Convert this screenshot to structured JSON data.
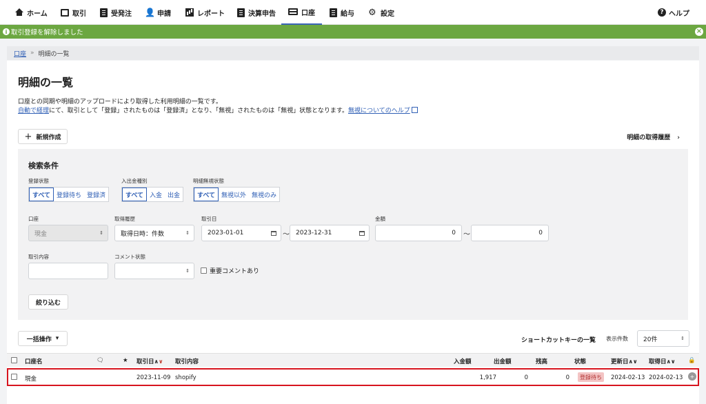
{
  "nav": {
    "items": [
      {
        "label": "ホーム",
        "icon": "home-icon"
      },
      {
        "label": "取引",
        "icon": "monitor-icon"
      },
      {
        "label": "受発注",
        "icon": "document-icon"
      },
      {
        "label": "申請",
        "icon": "person-check-icon"
      },
      {
        "label": "レポート",
        "icon": "bar-chart-icon"
      },
      {
        "label": "決算申告",
        "icon": "document-icon"
      },
      {
        "label": "口座",
        "icon": "credit-card-icon"
      },
      {
        "label": "給与",
        "icon": "list-icon"
      },
      {
        "label": "設定",
        "icon": "gear-icon"
      }
    ],
    "active": "口座",
    "help_label": "ヘルプ",
    "help_icon": "?"
  },
  "banner": {
    "message": "取引登録を解除しました",
    "info_icon": "i",
    "close_icon": "×",
    "color": "#6ca741"
  },
  "breadcrumb": {
    "parent": "口座",
    "separator": "»",
    "current": "明細の一覧"
  },
  "page": {
    "title": "明細の一覧",
    "desc_line1": "口座との同期や明細のアップロードにより取得した利用明細の一覧です。",
    "desc_link1": "自動で経理",
    "desc_line2": "にて、取引として「登録」されたものは「登録済」となり、「無視」されたものは「無視」状態となります。",
    "desc_link2": "無視についてのヘルプ",
    "new_button": "新規作成",
    "new_plus": "+",
    "history_link": "明細の取得履歴",
    "history_chevron": "›"
  },
  "search": {
    "title": "検索条件",
    "registration_label": "登録状態",
    "registration_options": [
      "すべて",
      "登録待ち",
      "登録済"
    ],
    "inout_label": "入出金種別",
    "inout_options": [
      "すべて",
      "入金",
      "出金"
    ],
    "ignore_label": "明細無視状態",
    "ignore_options": [
      "すべて",
      "無視以外",
      "無視のみ"
    ],
    "account_label": "口座",
    "account_value": "現金",
    "history_label": "取得履歴",
    "history_value": "取得日時：件数",
    "date_label": "取引日",
    "date_from": "2023-01-01",
    "date_to": "2023-12-31",
    "amount_label": "金額",
    "amount_from": "0",
    "amount_to": "0",
    "tilde": "〜",
    "content_label": "取引内容",
    "comment_label": "コメント状態",
    "important_comment": "重要コメントあり",
    "filter_button": "絞り込む",
    "select_arrow": "⇕"
  },
  "list": {
    "bulk_button": "一括操作",
    "bulk_caret": "▾",
    "shortcut_link": "ショートカットキーの一覧",
    "per_page_label": "表示件数",
    "per_page_value": "20件",
    "headers": {
      "account": "口座名",
      "comment_icon": "🗨",
      "star_icon": "★",
      "date": "取引日",
      "content": "取引内容",
      "income": "入金額",
      "expense": "出金額",
      "balance": "残高",
      "status": "状態",
      "updated": "更新日",
      "acquired": "取得日",
      "lock_icon": "🔒"
    },
    "sort_up": "∧",
    "sort_down": "∨",
    "rows": [
      {
        "account": "現金",
        "date": "2023-11-09",
        "content": "shopify",
        "income": "1,917",
        "expense": "0",
        "balance": "0",
        "status": "登録待ち",
        "updated": "2024-02-13",
        "acquired": "2024-02-13",
        "row_icon": "+"
      }
    ],
    "highlight_color": "#d7141e"
  }
}
